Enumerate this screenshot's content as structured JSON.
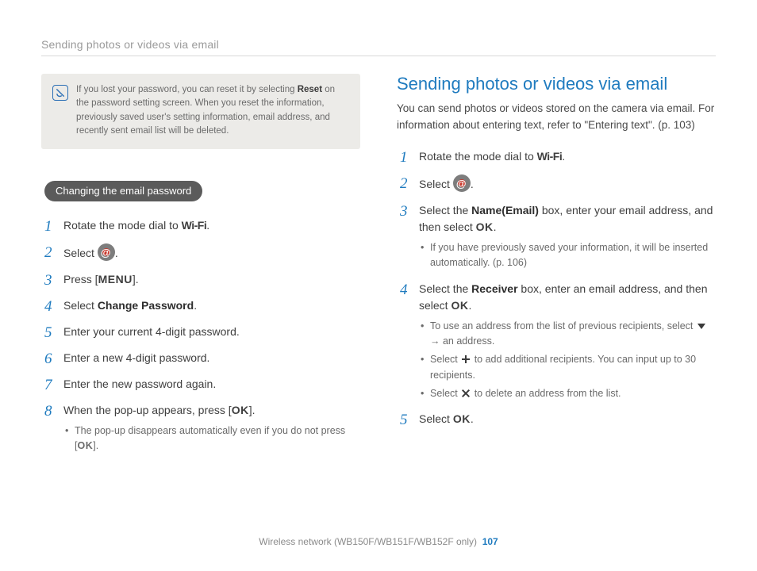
{
  "header": {
    "title": "Sending photos or videos via email"
  },
  "note": {
    "parts": [
      "If you lost your password, you can reset it by selecting ",
      "Reset",
      " on the password setting screen. When you reset the information, previously saved user's setting information, email address, and recently sent email list will be deleted."
    ]
  },
  "left": {
    "pill": "Changing the email password",
    "steps": {
      "s1a": "Rotate the mode dial to ",
      "wifi": "Wi-Fi",
      "s1b": ".",
      "s2a": "Select ",
      "s2b": ".",
      "s3a": "Press [",
      "menu": "MENU",
      "s3b": "].",
      "s4a": "Select ",
      "s4bold": "Change Password",
      "s4b": ".",
      "s5": "Enter your current 4-digit password.",
      "s6": "Enter a new 4-digit password.",
      "s7": "Enter the new password again.",
      "s8a": "When the pop-up appears, press [",
      "ok": "OK",
      "s8b": "].",
      "s8sub_a": "The pop-up disappears automatically even if you do not press [",
      "s8sub_b": "]."
    }
  },
  "right": {
    "title": "Sending photos or videos via email",
    "intro": "You can send photos or videos stored on the camera via email. For information about entering text, refer to \"Entering text\". (p. 103)",
    "steps": {
      "s1a": "Rotate the mode dial to ",
      "wifi": "Wi-Fi",
      "s1b": ".",
      "s2a": "Select ",
      "s2b": ".",
      "s3a": "Select the ",
      "s3bold": "Name(Email)",
      "s3b": " box, enter your email address, and then select ",
      "ok": "OK",
      "s3c": ".",
      "s3sub": "If you have previously saved your information, it will be inserted automatically. (p. 106)",
      "s4a": "Select the ",
      "s4bold": "Receiver",
      "s4b": " box, enter an email address, and then select ",
      "s4c": ".",
      "s4sub1a": "To use an address from the list of previous recipients, select ",
      "s4sub1b": " → an address.",
      "s4sub2a": "Select ",
      "s4sub2b": " to add additional recipients. You can input up to 30 recipients.",
      "s4sub3a": "Select ",
      "s4sub3b": " to delete an address from the list.",
      "s5a": "Select ",
      "s5b": "."
    }
  },
  "footer": {
    "text": "Wireless network (WB150F/WB151F/WB152F only)",
    "page": "107"
  }
}
